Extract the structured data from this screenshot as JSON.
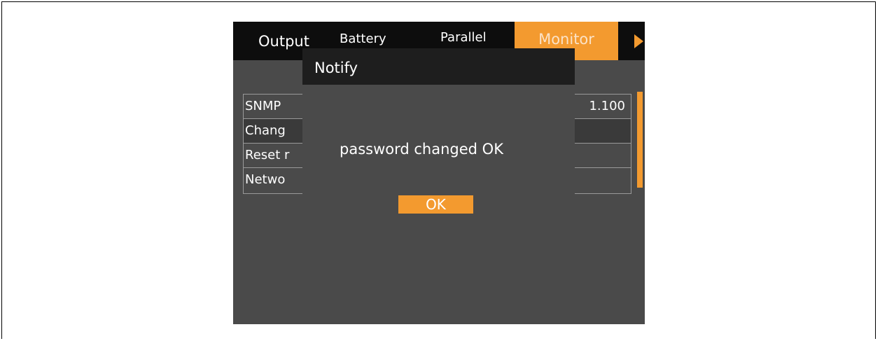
{
  "tabs": [
    {
      "label": "Output"
    },
    {
      "label": "Battery"
    },
    {
      "label": "Parallel"
    },
    {
      "label": "Monitor",
      "active": true
    }
  ],
  "list": {
    "rows": [
      {
        "label": "SNMP",
        "value": "1.100"
      },
      {
        "label": "Chang",
        "value": ""
      },
      {
        "label": "Reset r",
        "value": ""
      },
      {
        "label": "Netwo",
        "value": ""
      }
    ]
  },
  "dialog": {
    "title": "Notify",
    "message": "password changed OK",
    "ok_label": "OK"
  },
  "colors": {
    "accent": "#f39a2f",
    "screen_bg": "#4a4a4a",
    "tabbar_bg": "#0d0d0d",
    "dialog_title_bg": "#1e1e1e"
  },
  "icons": {
    "next_tab": "triangle-right-icon"
  }
}
